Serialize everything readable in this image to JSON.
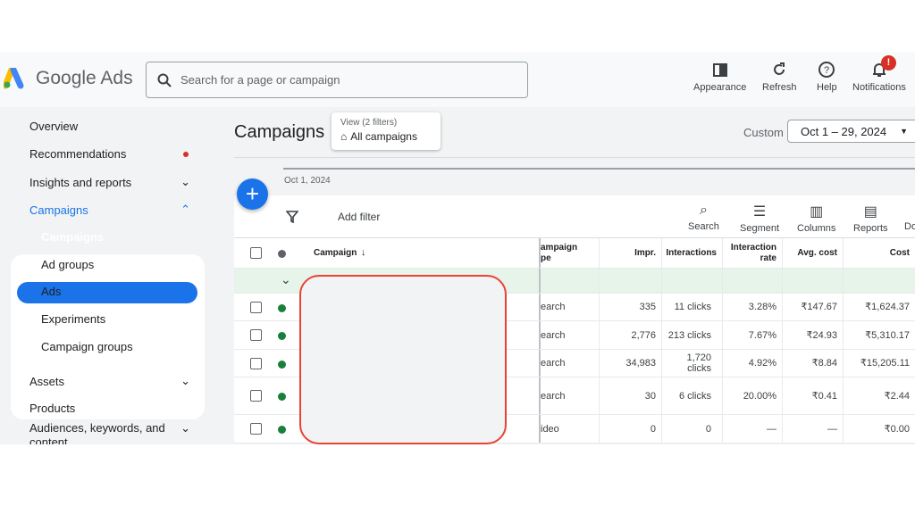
{
  "app": {
    "name": "Google Ads",
    "search_placeholder": "Search for a page or campaign"
  },
  "top_actions": [
    {
      "label": "Appearance",
      "icon": "appearance-icon"
    },
    {
      "label": "Refresh",
      "icon": "refresh-icon"
    },
    {
      "label": "Help",
      "icon": "help-icon"
    },
    {
      "label": "Notifications",
      "icon": "bell-icon",
      "badge": "!"
    }
  ],
  "sidebar": {
    "items": [
      {
        "label": "Overview"
      },
      {
        "label": "Recommendations"
      },
      {
        "label": "Insights and reports"
      },
      {
        "label": "Campaigns"
      },
      {
        "label": "Campaigns"
      },
      {
        "label": "Ad groups"
      },
      {
        "label": "Ads"
      },
      {
        "label": "Experiments"
      },
      {
        "label": "Campaign groups"
      },
      {
        "label": "Assets"
      },
      {
        "label": "Products"
      },
      {
        "label": "Audiences, keywords, and content"
      }
    ]
  },
  "main": {
    "title": "Campaigns",
    "view_label": "View (2 filters)",
    "view_value": "All campaigns",
    "date_prefix": "Custom",
    "date_range": "Oct 1 – 29, 2024",
    "chart_start": "Oct 1, 2024",
    "add_filter": "Add filter",
    "tools": [
      "Search",
      "Segment",
      "Columns",
      "Reports",
      "Do"
    ]
  },
  "table": {
    "headers": {
      "campaign": "Campaign",
      "type": "ampaign\npe",
      "impr": "Impr.",
      "interactions": "Interactions",
      "rate": "Interaction rate",
      "avg": "Avg. cost",
      "cost": "Cost"
    },
    "rows": [
      {
        "type": "earch",
        "impr": "335",
        "interactions": "11 clicks",
        "rate": "3.28%",
        "avg": "₹147.67",
        "cost": "₹1,624.37"
      },
      {
        "type": "earch",
        "impr": "2,776",
        "interactions": "213 clicks",
        "rate": "7.67%",
        "avg": "₹24.93",
        "cost": "₹5,310.17"
      },
      {
        "type": "earch",
        "impr": "34,983",
        "interactions": "1,720 clicks",
        "rate": "4.92%",
        "avg": "₹8.84",
        "cost": "₹15,205.11"
      },
      {
        "type": "earch",
        "impr": "30",
        "interactions": "6 clicks",
        "rate": "20.00%",
        "avg": "₹0.41",
        "cost": "₹2.44"
      },
      {
        "type": "ideo",
        "impr": "0",
        "interactions": "0",
        "rate": "—",
        "avg": "—",
        "cost": "₹0.00"
      }
    ]
  },
  "colors": {
    "accent": "#1a73e8",
    "enabled": "#188038",
    "redaction": "#ea4335",
    "summary_row": "#e6f4ea"
  }
}
